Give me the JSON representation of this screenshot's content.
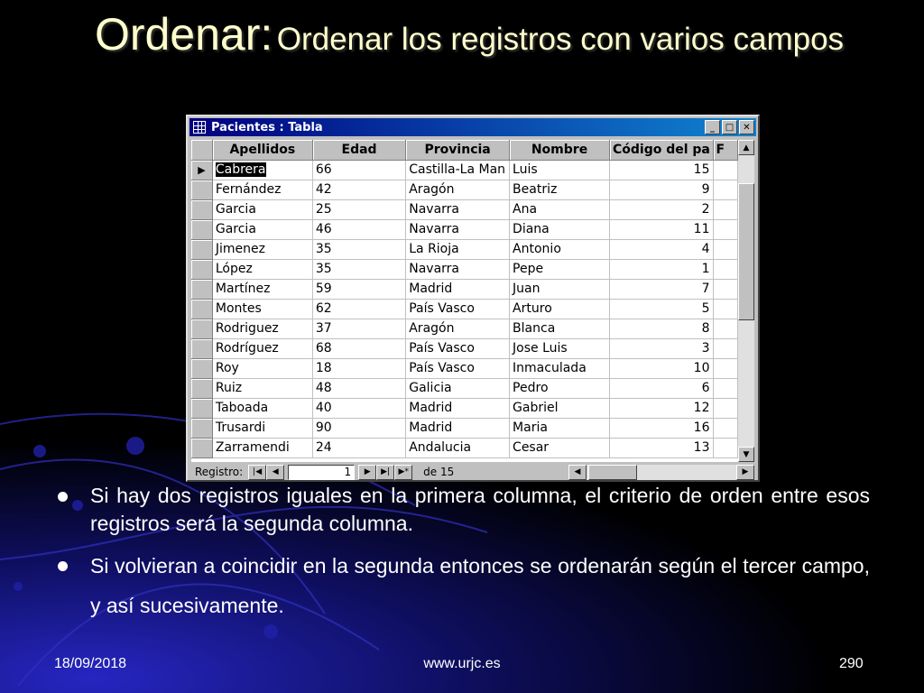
{
  "slide": {
    "title_main": "Ordenar:",
    "title_sub": "Ordenar los registros con varios campos"
  },
  "window": {
    "title": "Pacientes : Tabla",
    "min_glyph": "_",
    "max_glyph": "□",
    "close_glyph": "✕"
  },
  "table": {
    "columns": [
      "Apellidos",
      "Edad",
      "Provincia",
      "Nombre",
      "Código del pa",
      "F"
    ],
    "current_row_marker": "▶",
    "rows": [
      {
        "apellidos": "Cabrera",
        "edad": "66",
        "provincia": "Castilla-La Man",
        "nombre": "Luis",
        "codigo": "15"
      },
      {
        "apellidos": "Fernández",
        "edad": "42",
        "provincia": "Aragón",
        "nombre": "Beatriz",
        "codigo": "9"
      },
      {
        "apellidos": "Garcia",
        "edad": "25",
        "provincia": "Navarra",
        "nombre": "Ana",
        "codigo": "2"
      },
      {
        "apellidos": "Garcia",
        "edad": "46",
        "provincia": "Navarra",
        "nombre": "Diana",
        "codigo": "11"
      },
      {
        "apellidos": "Jimenez",
        "edad": "35",
        "provincia": "La Rioja",
        "nombre": "Antonio",
        "codigo": "4"
      },
      {
        "apellidos": "López",
        "edad": "35",
        "provincia": "Navarra",
        "nombre": "Pepe",
        "codigo": "1"
      },
      {
        "apellidos": "Martínez",
        "edad": "59",
        "provincia": "Madrid",
        "nombre": "Juan",
        "codigo": "7"
      },
      {
        "apellidos": "Montes",
        "edad": "62",
        "provincia": "País Vasco",
        "nombre": "Arturo",
        "codigo": "5"
      },
      {
        "apellidos": "Rodriguez",
        "edad": "37",
        "provincia": "Aragón",
        "nombre": "Blanca",
        "codigo": "8"
      },
      {
        "apellidos": "Rodríguez",
        "edad": "68",
        "provincia": "País Vasco",
        "nombre": "Jose Luis",
        "codigo": "3"
      },
      {
        "apellidos": "Roy",
        "edad": "18",
        "provincia": "País Vasco",
        "nombre": "Inmaculada",
        "codigo": "10"
      },
      {
        "apellidos": "Ruiz",
        "edad": "48",
        "provincia": "Galicia",
        "nombre": "Pedro",
        "codigo": "6"
      },
      {
        "apellidos": "Taboada",
        "edad": "40",
        "provincia": "Madrid",
        "nombre": "Gabriel",
        "codigo": "12"
      },
      {
        "apellidos": "Trusardi",
        "edad": "90",
        "provincia": "Madrid",
        "nombre": "Maria",
        "codigo": "16"
      },
      {
        "apellidos": "Zarramendi",
        "edad": "24",
        "provincia": "Andalucia",
        "nombre": "Cesar",
        "codigo": "13"
      }
    ]
  },
  "nav": {
    "label": "Registro:",
    "current": "1",
    "of_label": "de 15",
    "first_glyph": "|◀",
    "prev_glyph": "◀",
    "next_glyph": "▶",
    "last_glyph": "▶|",
    "new_glyph": "▶*"
  },
  "scroll": {
    "up_glyph": "▲",
    "down_glyph": "▼",
    "left_glyph": "◀",
    "right_glyph": "▶"
  },
  "bullets": [
    "Si hay dos registros iguales en la primera columna, el criterio de orden entre esos registros será la segunda columna.",
    "Si volvieran a coincidir en la segunda entonces se ordenarán según el tercer campo, y así sucesivamente."
  ],
  "footer": {
    "date": "18/09/2018",
    "site": "www.urjc.es",
    "page": "290"
  },
  "colors": {
    "title": "#ffffcc",
    "titlebar_start": "#000080",
    "titlebar_end": "#1084d0",
    "background_accent": "#1a1aa8"
  }
}
